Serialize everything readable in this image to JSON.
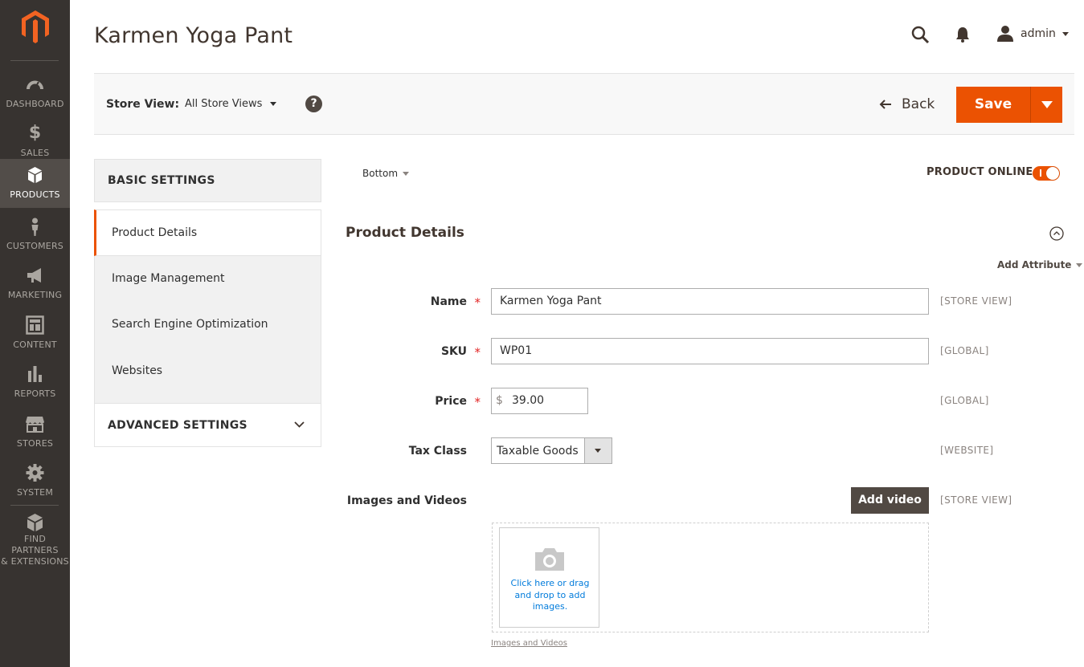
{
  "header": {
    "title": "Karmen Yoga Pant",
    "user_name": "admin"
  },
  "nav": {
    "items": [
      {
        "label": "DASHBOARD",
        "icon": "dashboard-icon"
      },
      {
        "label": "SALES",
        "icon": "dollar-icon"
      },
      {
        "label": "PRODUCTS",
        "icon": "cube-icon",
        "active": true
      },
      {
        "label": "CUSTOMERS",
        "icon": "person-icon"
      },
      {
        "label": "MARKETING",
        "icon": "megaphone-icon"
      },
      {
        "label": "CONTENT",
        "icon": "layout-icon"
      },
      {
        "label": "REPORTS",
        "icon": "bar-chart-icon"
      },
      {
        "label": "STORES",
        "icon": "storefront-icon"
      },
      {
        "label": "SYSTEM",
        "icon": "gear-icon"
      },
      {
        "label": "FIND PARTNERS\n& EXTENSIONS",
        "label_line1": "FIND PARTNERS",
        "label_line2": "& EXTENSIONS",
        "icon": "box-icon"
      }
    ]
  },
  "action_bar": {
    "store_view_label": "Store View:",
    "store_view_value": "All Store Views",
    "help": "?",
    "back_label": "Back",
    "save_label": "Save"
  },
  "settings": {
    "basic_title": "BASIC SETTINGS",
    "items": [
      "Product Details",
      "Image Management",
      "Search Engine Optimization",
      "Websites"
    ],
    "advanced_title": "ADVANCED SETTINGS"
  },
  "main": {
    "position_select": "Bottom",
    "product_online_label": "PRODUCT ONLINE",
    "product_online": true,
    "section_title": "Product Details",
    "add_attribute": "Add Attribute",
    "fields": {
      "name": {
        "label": "Name",
        "value": "Karmen Yoga Pant",
        "scope": "[STORE VIEW]",
        "required": "*"
      },
      "sku": {
        "label": "SKU",
        "value": "WP01",
        "scope": "[GLOBAL]",
        "required": "*"
      },
      "price": {
        "label": "Price",
        "currency": "$",
        "value": "39.00",
        "scope": "[GLOBAL]",
        "required": "*"
      },
      "tax_class": {
        "label": "Tax Class",
        "value": "Taxable Goods",
        "scope": "[WEBSITE]"
      },
      "images": {
        "label": "Images and Videos",
        "scope": "[STORE VIEW]",
        "add_video": "Add video",
        "upload_text": "Click here or drag and drop to add images.",
        "link": "Images and Videos"
      }
    }
  },
  "colors": {
    "accent": "#eb5202",
    "nav_bg": "#373330",
    "nav_active": "#524d49",
    "link": "#007bdb"
  }
}
